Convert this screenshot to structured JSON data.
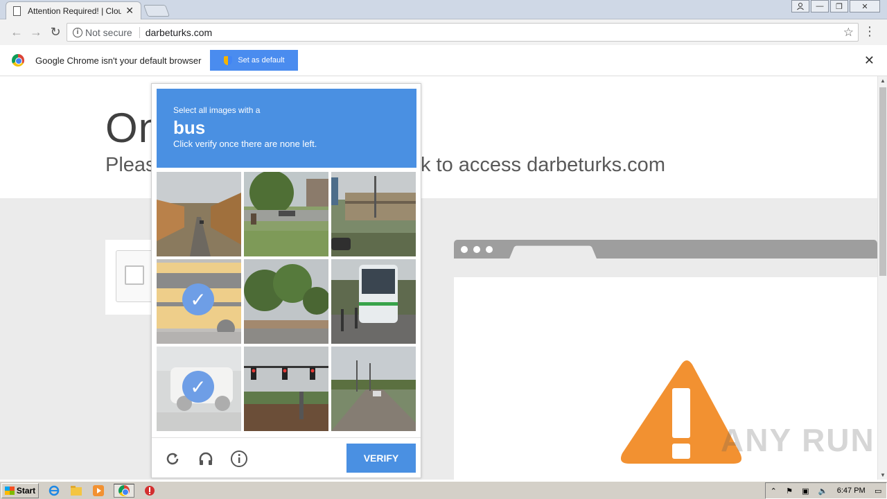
{
  "browser": {
    "tab_title": "Attention Required! | Cloudf",
    "address": {
      "security": "Not secure",
      "url": "darbeturks.com"
    }
  },
  "infobar": {
    "message": "Google Chrome isn't your default browser",
    "button_label": "Set as default"
  },
  "page": {
    "title_fragment": "On",
    "subtitle_left": "Pleas",
    "subtitle_right": "k to access darbeturks.com"
  },
  "captcha": {
    "prompt_small": "Select all images with a",
    "target": "bus",
    "instruction": "Click verify once there are none left.",
    "verify_label": "VERIFY",
    "tiles": [
      {
        "id": 1,
        "selected": false
      },
      {
        "id": 2,
        "selected": false
      },
      {
        "id": 3,
        "selected": false
      },
      {
        "id": 4,
        "selected": true
      },
      {
        "id": 5,
        "selected": false
      },
      {
        "id": 6,
        "selected": false
      },
      {
        "id": 7,
        "selected": true
      },
      {
        "id": 8,
        "selected": false
      },
      {
        "id": 9,
        "selected": false
      }
    ]
  },
  "watermark": "ANY RUN",
  "taskbar": {
    "start_label": "Start",
    "clock": "6:47 PM"
  },
  "colors": {
    "accent": "#4a90e2",
    "warning": "#f29131",
    "infobar_button": "#4a8cef"
  }
}
